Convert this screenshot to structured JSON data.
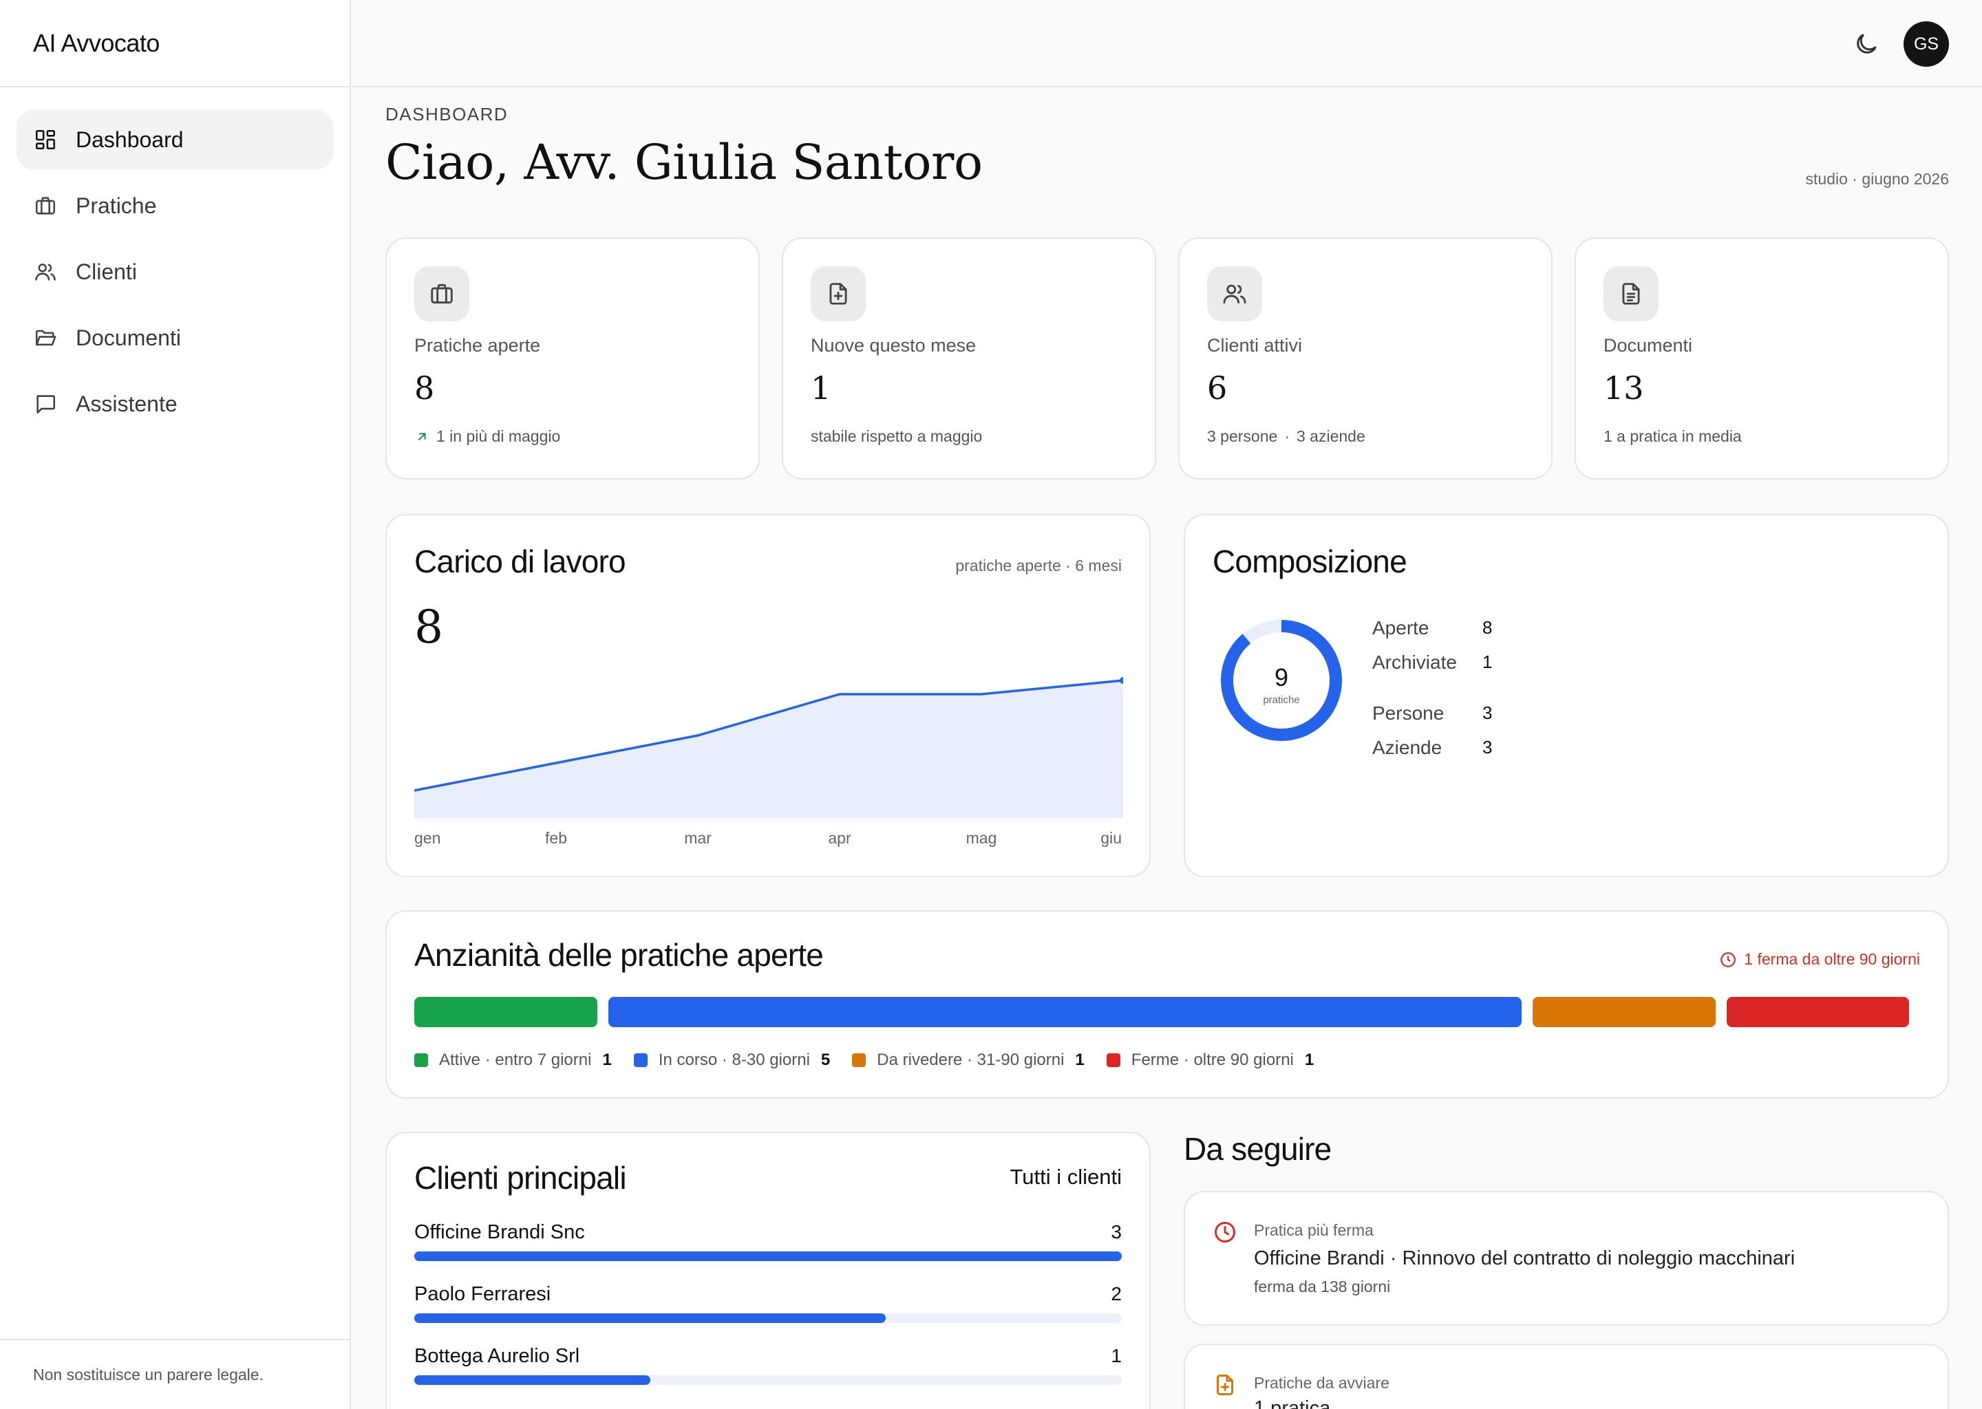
{
  "app": {
    "title": "AI Avvocato"
  },
  "sidebar": {
    "items": [
      {
        "label": "Dashboard",
        "icon": "dashboard-icon"
      },
      {
        "label": "Pratiche",
        "icon": "briefcase-icon"
      },
      {
        "label": "Clienti",
        "icon": "users-icon"
      },
      {
        "label": "Documenti",
        "icon": "folder-icon"
      },
      {
        "label": "Assistente",
        "icon": "chat-icon"
      }
    ],
    "footer": "Non sostituisce un parere legale."
  },
  "topbar": {
    "avatar_initials": "GS",
    "theme_icon": "moon-icon"
  },
  "header": {
    "eyebrow": "DASHBOARD",
    "greeting": "Ciao, Avv. Giulia Santoro",
    "studio": "studio",
    "period": "giugno 2026"
  },
  "stats": [
    {
      "icon": "briefcase-icon",
      "label": "Pratiche aperte",
      "value": "8",
      "note": "1 in più di maggio",
      "trend": "up"
    },
    {
      "icon": "file-plus-icon",
      "label": "Nuove questo mese",
      "value": "1",
      "note": "stabile rispetto a maggio"
    },
    {
      "icon": "users-icon",
      "label": "Clienti attivi",
      "value": "6",
      "note_a": "3 persone",
      "note_b": "3 aziende"
    },
    {
      "icon": "document-icon",
      "label": "Documenti",
      "value": "13",
      "note": "1 a pratica in media"
    }
  ],
  "workload": {
    "title": "Carico di lavoro",
    "meta_a": "pratiche aperte",
    "meta_b": "6 mesi",
    "value": "8"
  },
  "chart_data": {
    "type": "area",
    "x": [
      "gen",
      "feb",
      "mar",
      "apr",
      "mag",
      "giu"
    ],
    "values": [
      3,
      4,
      5,
      6.5,
      6.5,
      7
    ],
    "ylim": [
      2,
      8
    ],
    "grid": false,
    "color": "#2563eb",
    "fill": "#e8eefb"
  },
  "composition": {
    "title": "Composizione",
    "total": "9",
    "total_label": "pratiche",
    "rows": [
      {
        "label": "Aperte",
        "value": "8"
      },
      {
        "label": "Archiviate",
        "value": "1"
      },
      {
        "label": "Persone",
        "value": "3"
      },
      {
        "label": "Aziende",
        "value": "3"
      }
    ],
    "open_fraction": 0.889,
    "colors": {
      "open": "#2563eb",
      "archived": "#e8eefb"
    }
  },
  "aging": {
    "title": "Anzianità delle pratiche aperte",
    "warning": "1 ferma da oltre 90 giorni",
    "buckets": [
      {
        "name": "Attive",
        "range": "entro 7 giorni",
        "count": 1,
        "color": "#16a34a"
      },
      {
        "name": "In corso",
        "range": "8-30 giorni",
        "count": 5,
        "color": "#2563eb"
      },
      {
        "name": "Da rivedere",
        "range": "31-90 giorni",
        "count": 1,
        "color": "#d97706"
      },
      {
        "name": "Ferme",
        "range": "oltre 90 giorni",
        "count": 1,
        "color": "#dc2626"
      }
    ]
  },
  "clients": {
    "title": "Clienti principali",
    "link": "Tutti i clienti",
    "rows": [
      {
        "name": "Officine Brandi Snc",
        "count": 3
      },
      {
        "name": "Paolo Ferraresi",
        "count": 2
      },
      {
        "name": "Bottega Aurelio Srl",
        "count": 1
      }
    ],
    "max": 3
  },
  "follow": {
    "title": "Da seguire",
    "items": [
      {
        "icon": "clock-icon",
        "kicker": "Pratica più ferma",
        "client": "Officine Brandi",
        "matter": "Rinnovo del contratto di noleggio macchinari",
        "sub": "ferma da 138 giorni",
        "color": "#d92d20"
      },
      {
        "icon": "file-plus-icon",
        "kicker": "Pratiche da avviare",
        "sub": "1 pratica",
        "color": "#d97706"
      }
    ]
  }
}
